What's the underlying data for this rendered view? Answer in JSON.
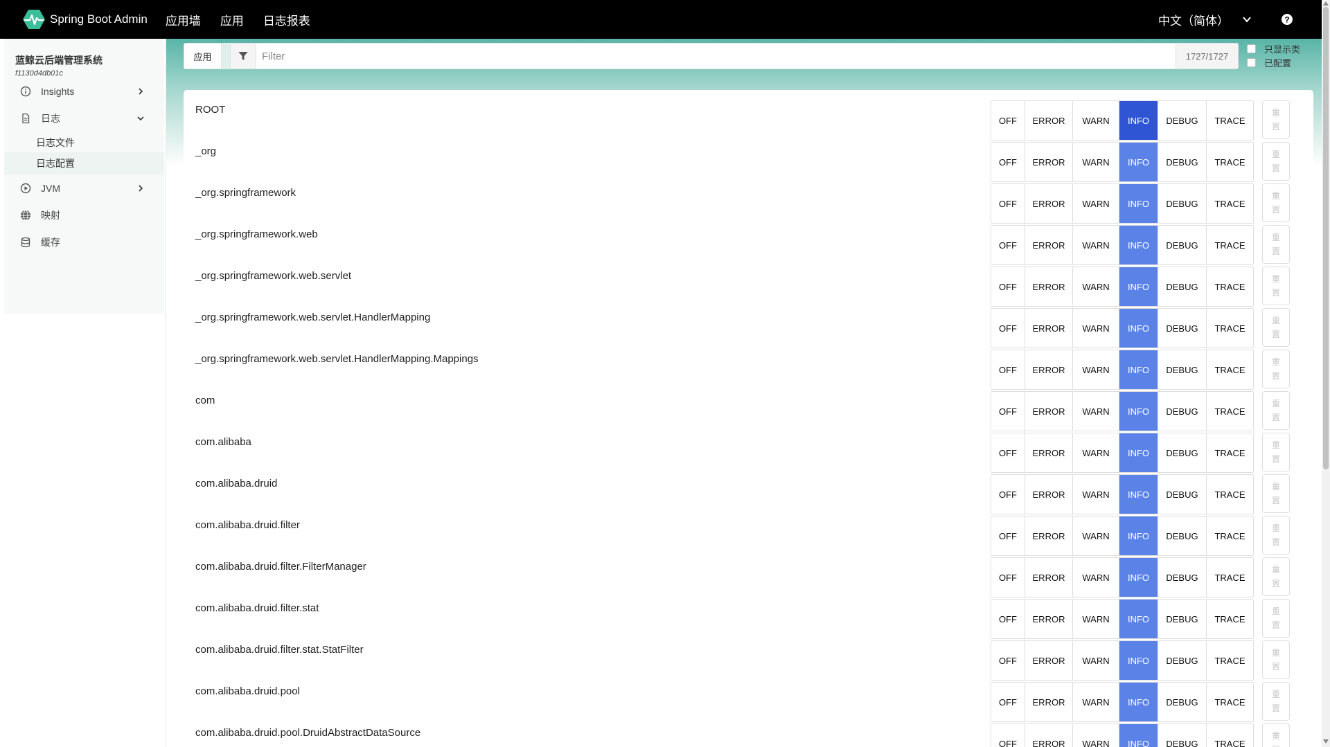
{
  "topbar": {
    "brand": "Spring Boot Admin",
    "nav": [
      "应用墙",
      "应用",
      "日志报表"
    ],
    "language": "中文（简体）",
    "colors": {
      "background": "#000000",
      "logo": "#3bbf9a"
    }
  },
  "sidebar": {
    "app_name": "蓝鲸云后端管理系统",
    "app_id": "f1130d4db01c",
    "items": [
      {
        "label": "Insights",
        "icon": "info-circle-icon",
        "expanded": false
      },
      {
        "label": "日志",
        "icon": "file-icon",
        "expanded": true
      },
      {
        "label": "JVM",
        "icon": "play-circle-icon",
        "expanded": false
      },
      {
        "label": "映射",
        "icon": "globe-icon"
      },
      {
        "label": "缓存",
        "icon": "database-icon"
      }
    ],
    "subitems": [
      "日志文件",
      "日志配置"
    ],
    "active_subitem": "日志配置"
  },
  "filter": {
    "app_button": "应用",
    "placeholder": "Filter",
    "count": "1727/1727",
    "checkboxes": [
      "只显示类",
      "已配置"
    ]
  },
  "levels": [
    "OFF",
    "ERROR",
    "WARN",
    "INFO",
    "DEBUG",
    "TRACE"
  ],
  "reset_label": [
    "重",
    "置"
  ],
  "colors": {
    "info_explicit": "#2f55d4",
    "info_inherited": "#5b82e6"
  },
  "loggers": [
    {
      "name": "ROOT",
      "level": "INFO",
      "explicit": true
    },
    {
      "name": "_org",
      "level": "INFO",
      "explicit": false
    },
    {
      "name": "_org.springframework",
      "level": "INFO",
      "explicit": false
    },
    {
      "name": "_org.springframework.web",
      "level": "INFO",
      "explicit": false
    },
    {
      "name": "_org.springframework.web.servlet",
      "level": "INFO",
      "explicit": false
    },
    {
      "name": "_org.springframework.web.servlet.HandlerMapping",
      "level": "INFO",
      "explicit": false
    },
    {
      "name": "_org.springframework.web.servlet.HandlerMapping.Mappings",
      "level": "INFO",
      "explicit": false
    },
    {
      "name": "com",
      "level": "INFO",
      "explicit": false
    },
    {
      "name": "com.alibaba",
      "level": "INFO",
      "explicit": false
    },
    {
      "name": "com.alibaba.druid",
      "level": "INFO",
      "explicit": false
    },
    {
      "name": "com.alibaba.druid.filter",
      "level": "INFO",
      "explicit": false
    },
    {
      "name": "com.alibaba.druid.filter.FilterManager",
      "level": "INFO",
      "explicit": false
    },
    {
      "name": "com.alibaba.druid.filter.stat",
      "level": "INFO",
      "explicit": false
    },
    {
      "name": "com.alibaba.druid.filter.stat.StatFilter",
      "level": "INFO",
      "explicit": false
    },
    {
      "name": "com.alibaba.druid.pool",
      "level": "INFO",
      "explicit": false
    },
    {
      "name": "com.alibaba.druid.pool.DruidAbstractDataSource",
      "level": "INFO",
      "explicit": false
    }
  ]
}
